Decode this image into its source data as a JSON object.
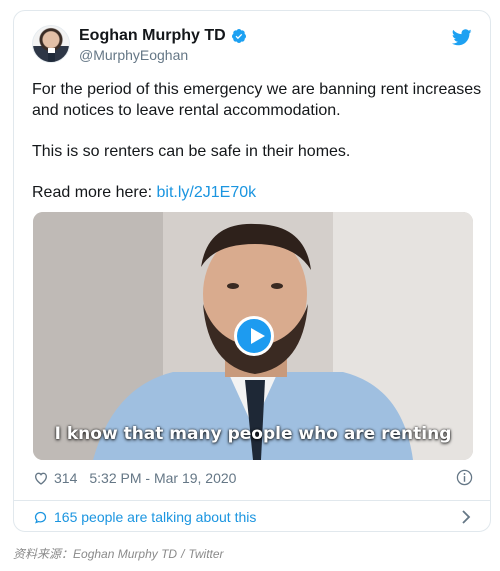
{
  "tweet": {
    "display_name": "Eoghan Murphy TD",
    "handle": "@MurphyEoghan",
    "icons": {
      "verified": "verified-badge-icon",
      "brand": "twitter-bird-icon",
      "avatar": "avatar"
    },
    "text_line_1": "For the period of this emergency we are banning rent increases and notices to leave rental accommodation.",
    "text_line_2": "This is so renters can be safe in their homes.",
    "read_more_prefix": "Read more here: ",
    "read_more_link": "bit.ly/2J1E70k",
    "video": {
      "caption": "I know that many people who are renting",
      "play_icon": "play-icon"
    },
    "likes": "314",
    "timestamp": "5:32 PM - Mar 19, 2020",
    "talking": "165 people are talking about this"
  },
  "source": {
    "label": "资料来源：",
    "name": "Eoghan Murphy TD",
    "separator": "/",
    "platform": "Twitter"
  },
  "colors": {
    "link": "#1b95e0",
    "text": "#14171a",
    "muted": "#657786",
    "border": "#e1e8ed",
    "play": "#1d9bf0"
  }
}
